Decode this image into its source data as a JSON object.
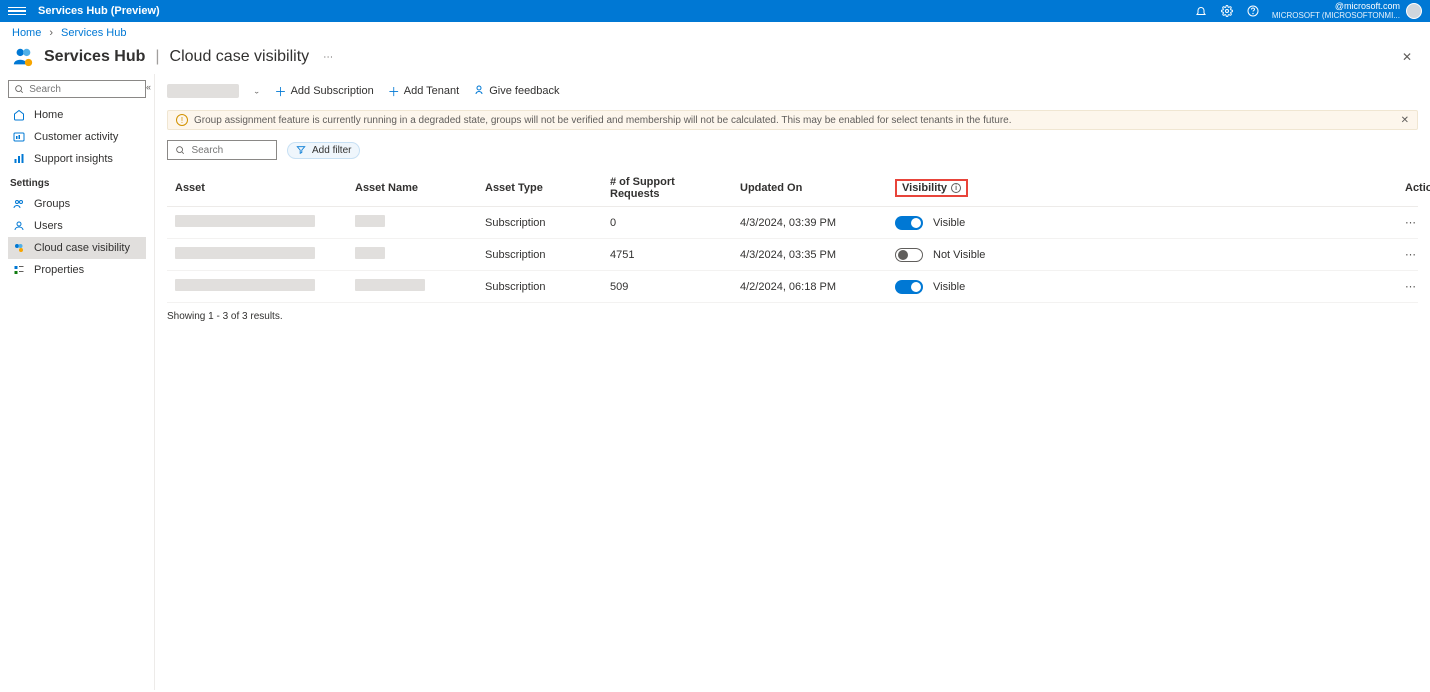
{
  "topbar": {
    "title": "Services Hub (Preview)",
    "user_email": "@microsoft.com",
    "user_org": "MICROSOFT (MICROSOFTONMI..."
  },
  "breadcrumb": {
    "items": [
      "Home",
      "Services Hub"
    ]
  },
  "page": {
    "title": "Services Hub",
    "subtitle": "Cloud case visibility"
  },
  "sidebar": {
    "search_placeholder": "Search",
    "items": [
      {
        "label": "Home",
        "icon": "home-icon"
      },
      {
        "label": "Customer activity",
        "icon": "activity-icon"
      },
      {
        "label": "Support insights",
        "icon": "insights-icon"
      }
    ],
    "section_label": "Settings",
    "settings_items": [
      {
        "label": "Groups",
        "icon": "groups-icon"
      },
      {
        "label": "Users",
        "icon": "user-icon"
      },
      {
        "label": "Cloud case visibility",
        "icon": "visibility-icon",
        "active": true
      },
      {
        "label": "Properties",
        "icon": "properties-icon"
      }
    ]
  },
  "toolbar": {
    "add_subscription": "Add Subscription",
    "add_tenant": "Add Tenant",
    "give_feedback": "Give feedback"
  },
  "banner": {
    "text": "Group assignment feature is currently running in a degraded state, groups will not be verified and membership will not be calculated. This may be enabled for select tenants in the future."
  },
  "filter": {
    "search_placeholder": "Search",
    "add_filter": "Add filter"
  },
  "table": {
    "headers": {
      "asset": "Asset",
      "asset_name": "Asset Name",
      "asset_type": "Asset Type",
      "requests": "# of Support Requests",
      "updated": "Updated On",
      "visibility": "Visibility",
      "actions": "Actions"
    },
    "rows": [
      {
        "type": "Subscription",
        "requests": "0",
        "updated": "4/3/2024, 03:39 PM",
        "visible": true,
        "vis_label": "Visible"
      },
      {
        "type": "Subscription",
        "requests": "4751",
        "updated": "4/3/2024, 03:35 PM",
        "visible": false,
        "vis_label": "Not Visible"
      },
      {
        "type": "Subscription",
        "requests": "509",
        "updated": "4/2/2024, 06:18 PM",
        "visible": true,
        "vis_label": "Visible"
      }
    ],
    "results_text": "Showing 1 - 3 of 3 results."
  }
}
